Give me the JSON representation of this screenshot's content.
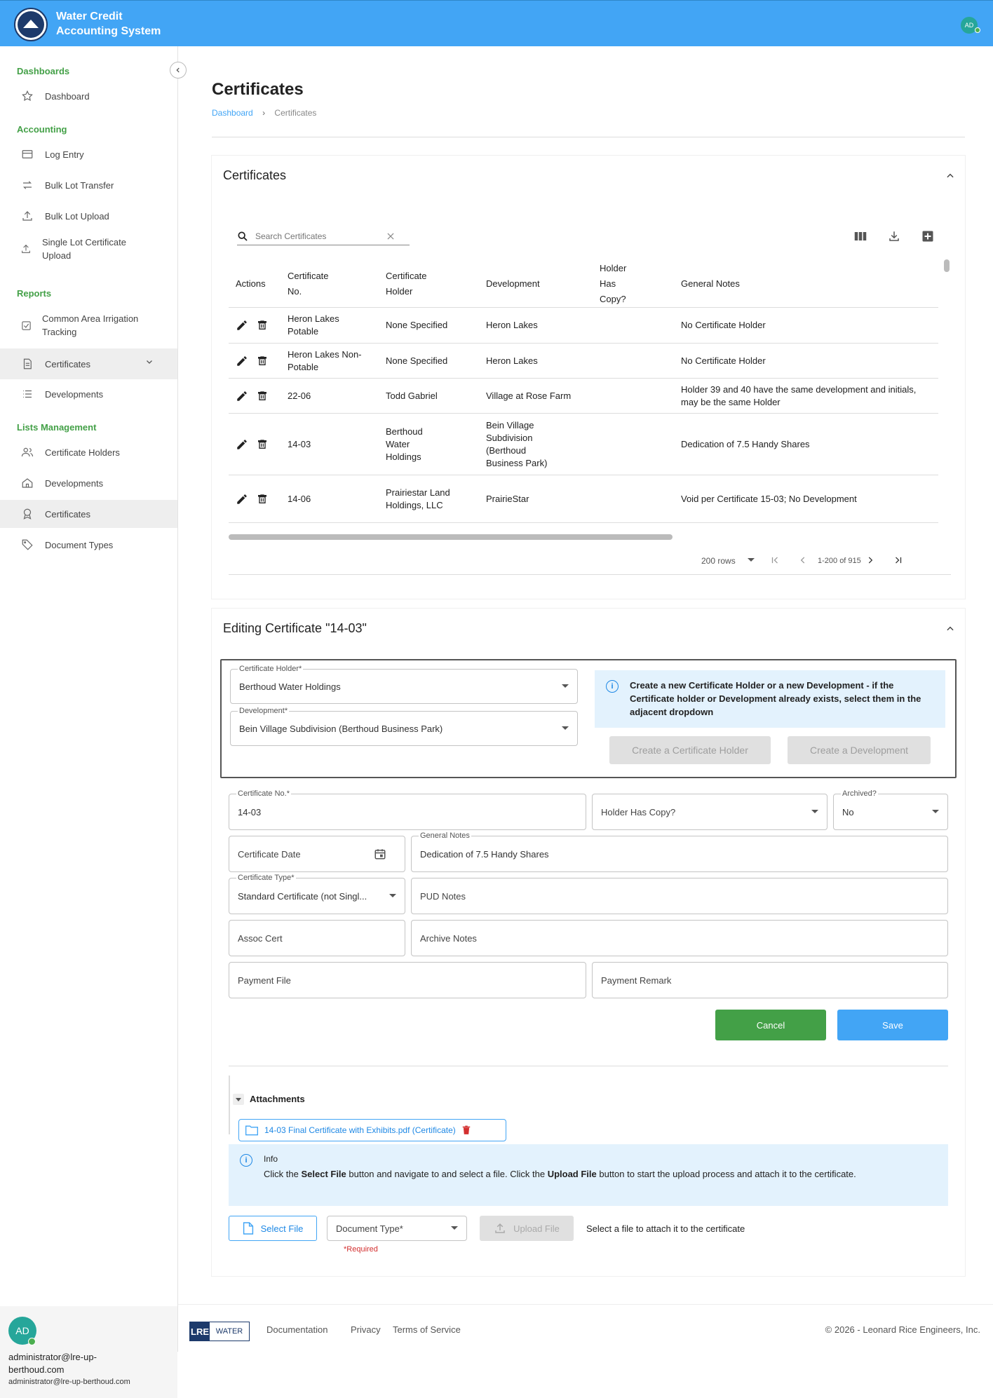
{
  "app": {
    "title": "Water Credit Accounting System",
    "avatar_initials": "AD"
  },
  "sidebar": {
    "sections": {
      "dashboards": "Dashboards",
      "accounting": "Accounting",
      "reports": "Reports",
      "lists": "Lists Management"
    },
    "items": {
      "dashboard": "Dashboard",
      "log_entry": "Log Entry",
      "bulk_lot_transfer": "Bulk Lot Transfer",
      "bulk_lot_upload": "Bulk Lot Upload",
      "single_lot_upload": "Single Lot Certificate Upload",
      "common_area": "Common Area Irrigation Tracking",
      "certificates_reports": "Certificates",
      "developments_reports": "Developments",
      "certificate_holders": "Certificate Holders",
      "developments_lists": "Developments",
      "certificates_lists": "Certificates",
      "document_types": "Document Types"
    },
    "user": {
      "initials": "AD",
      "name": "administrator@lre-up-berthoud.com",
      "email": "administrator@lre-up-berthoud.com"
    }
  },
  "page": {
    "title": "Certificates",
    "breadcrumb": {
      "home": "Dashboard",
      "current": "Certificates"
    }
  },
  "table_card": {
    "title": "Certificates",
    "search_placeholder": "Search Certificates",
    "columns": {
      "actions": "Actions",
      "cert_no": "Certificate No.",
      "holder": "Certificate Holder",
      "development": "Development",
      "holder_copy": "Holder Has Copy?",
      "notes": "General Notes"
    },
    "rows": [
      {
        "cert_no": "Heron Lakes Potable",
        "holder": "None Specified",
        "development": "Heron Lakes",
        "copy": "",
        "notes": "No Certificate Holder"
      },
      {
        "cert_no": "Heron Lakes Non-Potable",
        "holder": "None Specified",
        "development": "Heron Lakes",
        "copy": "",
        "notes": "No Certificate Holder"
      },
      {
        "cert_no": "22-06",
        "holder": "Todd Gabriel",
        "development": "Village at Rose Farm",
        "copy": "",
        "notes": "Holder 39 and 40 have the same development and initials, may be the same Holder"
      },
      {
        "cert_no": "14-03",
        "holder": "Berthoud Water Holdings",
        "development": "Bein Village Subdivision (Berthoud Business Park)",
        "copy": "",
        "notes": "Dedication of 7.5 Handy Shares"
      },
      {
        "cert_no": "14-06",
        "holder": "Prairiestar Land Holdings, LLC",
        "development": "PrairieStar",
        "copy": "",
        "notes": "Void per Certificate 15-03; No Development"
      }
    ],
    "pager": {
      "rows_per_page": "200 rows",
      "range": "1-200 of 915"
    }
  },
  "edit_card": {
    "title": "Editing Certificate \"14-03\"",
    "holder": {
      "label": "Certificate Holder*",
      "value": "Berthoud Water Holdings"
    },
    "development": {
      "label": "Development*",
      "value": "Bein Village Subdivision (Berthoud Business Park)"
    },
    "info": "Create a new Certificate Holder or a new Development - if the Certificate holder or Development already exists, select them in the adjacent dropdown",
    "create_holder": "Create a Certificate Holder",
    "create_development": "Create a Development",
    "cert_no": {
      "label": "Certificate No.*",
      "value": "14-03"
    },
    "holder_copy": {
      "placeholder": "Holder Has Copy?"
    },
    "archived": {
      "label": "Archived?",
      "value": "No"
    },
    "cert_date": {
      "placeholder": "Certificate Date"
    },
    "general_notes": {
      "label": "General Notes",
      "value": "Dedication of 7.5 Handy Shares"
    },
    "cert_type": {
      "label": "Certificate Type*",
      "value": "Standard Certificate (not Singl..."
    },
    "pud_notes": {
      "placeholder": "PUD Notes"
    },
    "assoc_cert": {
      "placeholder": "Assoc Cert"
    },
    "archive_notes": {
      "placeholder": "Archive Notes"
    },
    "payment_file": {
      "placeholder": "Payment File"
    },
    "payment_remark": {
      "placeholder": "Payment Remark"
    },
    "cancel": "Cancel",
    "save": "Save",
    "attachments": {
      "title": "Attachments",
      "file": "14-03 Final Certificate with Exhibits.pdf (Certificate)"
    },
    "upload_info": {
      "title": "Info",
      "text_pre": "Click the ",
      "select_bold": "Select File",
      "text_mid": " button and navigate to and select a file. Click the ",
      "upload_bold": "Upload File",
      "text_post": " button to start the upload process and attach it to the certificate."
    },
    "select_file": "Select File",
    "document_type": "Document Type*",
    "required": "*Required",
    "upload_file": "Upload File",
    "upload_hint": "Select a file to attach it to the certificate"
  },
  "footer": {
    "brand_left": "LRE",
    "brand_right": "WATER",
    "documentation": "Documentation",
    "privacy": "Privacy",
    "terms": "Terms of Service",
    "copyright": "© 2026 - Leonard Rice Engineers, Inc."
  },
  "colors": {
    "primary": "#42a5f5",
    "accent_green": "#43a047",
    "cancel_button": "#43a047",
    "save_button": "#42a5f5",
    "delete_red": "#d32f2f"
  }
}
